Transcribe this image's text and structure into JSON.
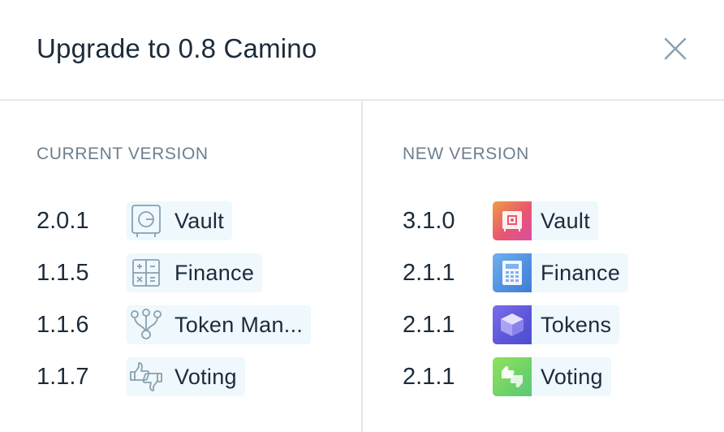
{
  "dialog": {
    "title": "Upgrade to 0.8 Camino",
    "close_icon": "close-icon"
  },
  "current": {
    "heading": "CURRENT VERSION",
    "apps": [
      {
        "version": "2.0.1",
        "name": "Vault",
        "icon": "vault-icon"
      },
      {
        "version": "1.1.5",
        "name": "Finance",
        "icon": "calculator-icon"
      },
      {
        "version": "1.1.6",
        "name": "Token Man...",
        "icon": "token-manager-icon"
      },
      {
        "version": "1.1.7",
        "name": "Voting",
        "icon": "thumbs-vote-icon"
      }
    ]
  },
  "new": {
    "heading": "NEW VERSION",
    "apps": [
      {
        "version": "3.1.0",
        "name": "Vault",
        "icon": "vault-icon",
        "color": "#e8566f"
      },
      {
        "version": "2.1.1",
        "name": "Finance",
        "icon": "calculator-icon",
        "color": "#4f8fe0"
      },
      {
        "version": "2.1.1",
        "name": "Tokens",
        "icon": "cube-icon",
        "color": "#5c55d8"
      },
      {
        "version": "2.1.1",
        "name": "Voting",
        "icon": "thumbs-vote-icon",
        "color": "#6ed26a"
      }
    ]
  },
  "colors": {
    "chip_background": "#eef8fd",
    "heading": "#6d7f8f",
    "text": "#1c2b3a",
    "divider": "#e3e8ec",
    "outline_icon": "#8aa0ae"
  }
}
